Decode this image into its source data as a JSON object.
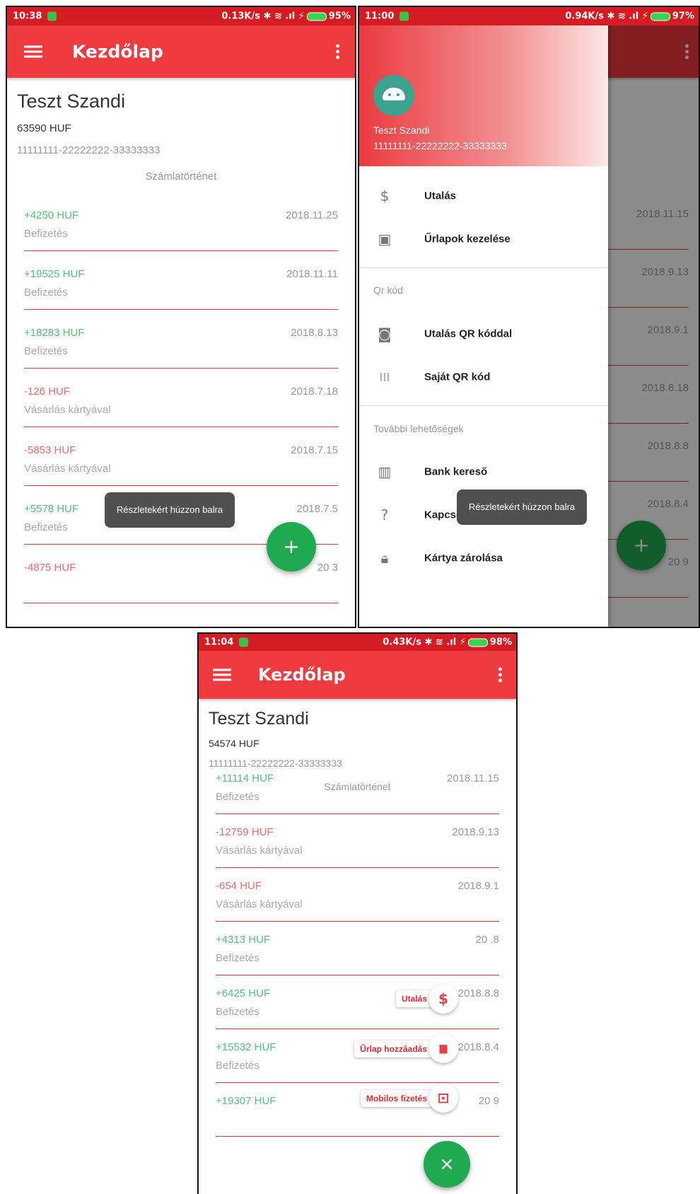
{
  "screen1": {
    "status": {
      "time": "10:38",
      "right": "0.13K/s ✱ ≋ .ıl ⚡",
      "battery": "95%"
    },
    "appbar": {
      "title": "Kezdőlap"
    },
    "account": {
      "name": "Teszt Szandi",
      "balance": "63590 HUF",
      "number": "11111111-22222222-33333333"
    },
    "history_title": "Számlatörténet",
    "transactions": [
      {
        "amount": "+4250 HUF",
        "date": "2018.11.25",
        "desc": "Befizetés"
      },
      {
        "amount": "+19525 HUF",
        "date": "2018.11.11",
        "desc": "Befizetés"
      },
      {
        "amount": "+18283 HUF",
        "date": "2018.8.13",
        "desc": "Befizetés"
      },
      {
        "amount": "-126 HUF",
        "date": "2018.7.18",
        "desc": "Vásárlás kártyával"
      },
      {
        "amount": "-5853 HUF",
        "date": "2018.7.15",
        "desc": "Vásárlás kártyával"
      },
      {
        "amount": "+5578 HUF",
        "date": "2018.7.5",
        "desc": "Befizetés"
      },
      {
        "amount": "-4875 HUF",
        "date": "20  3",
        "desc": ""
      }
    ],
    "toast": "Részletekért húzzon balra",
    "fab": "+"
  },
  "screen2": {
    "status": {
      "time": "11:00",
      "right": "0.94K/s ✱ ≋ .ıl ⚡",
      "battery": "97%"
    },
    "drawer": {
      "user_name": "Teszt Szandi",
      "user_account": "11111111-22222222-33333333",
      "items_main": [
        {
          "label": "Utalás",
          "icon": "dollar-icon"
        },
        {
          "label": "Űrlapok kezelése",
          "icon": "clipboard-account-icon"
        }
      ],
      "section_qr": "Qr kód",
      "items_qr": [
        {
          "label": "Utalás QR kóddal",
          "icon": "camera-icon"
        },
        {
          "label": "Saját QR kód",
          "icon": "qr-code-icon"
        }
      ],
      "section_more": "További lehetőségek",
      "items_more": [
        {
          "label": "Bank kereső",
          "icon": "map-icon"
        },
        {
          "label": "Kapcsolat",
          "icon": "help-circle-icon"
        },
        {
          "label": "Kártya zárolása",
          "icon": "lock-icon"
        }
      ]
    },
    "behind_dates": [
      "2018.11.15",
      "2018.9.13",
      "2018.9.1",
      "2018.8.18",
      "2018.8.8",
      "2018.8.4",
      "20   9"
    ],
    "toast": "Részletekért húzzon balra",
    "fab": "+"
  },
  "screen3": {
    "status": {
      "time": "11:04",
      "right": "0.43K/s ✱ ≋ .ıl ⚡",
      "battery": "98%"
    },
    "appbar": {
      "title": "Kezdőlap"
    },
    "account": {
      "name": "Teszt Szandi",
      "balance": "54574 HUF",
      "number": "11111111-22222222-33333333"
    },
    "history_title": "Számlatörténet",
    "transactions": [
      {
        "amount": "+11114 HUF",
        "date": "2018.11.15",
        "desc": "Befizetés"
      },
      {
        "amount": "-12759 HUF",
        "date": "2018.9.13",
        "desc": "Vásárlás kártyával"
      },
      {
        "amount": "-654 HUF",
        "date": "2018.9.1",
        "desc": "Vásárlás kártyával"
      },
      {
        "amount": "+4313 HUF",
        "date": "20  .8",
        "desc": "Befizetés"
      },
      {
        "amount": "+6425 HUF",
        "date": "2018.8.8",
        "desc": "Befizetés"
      },
      {
        "amount": "+15532 HUF",
        "date": "2018.8.4",
        "desc": "Befizetés"
      },
      {
        "amount": "+19307 HUF",
        "date": "20   9",
        "desc": ""
      }
    ],
    "speed_dial": [
      {
        "label": "Utalás",
        "icon": "dollar-icon",
        "glyph": "$"
      },
      {
        "label": "Űrlap hozzáadás",
        "icon": "folder-plus-icon",
        "glyph": "▆"
      },
      {
        "label": "Mobilos fizetés",
        "icon": "nfc-icon",
        "glyph": "⊡"
      }
    ],
    "fab": "×"
  }
}
